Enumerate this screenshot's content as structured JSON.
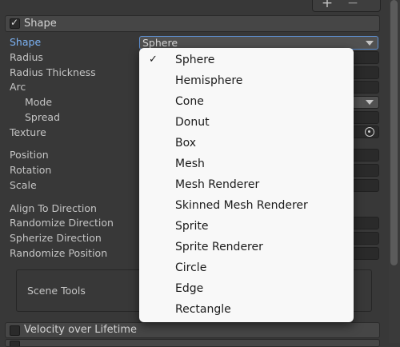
{
  "toolbar": {
    "plus": "+",
    "minus": "−"
  },
  "shape_module": {
    "title": "Shape",
    "enabled": true,
    "fields": {
      "shape": {
        "label": "Shape",
        "value": "Sphere"
      },
      "radius": "Radius",
      "radius_thickness": "Radius Thickness",
      "arc": "Arc",
      "mode": "Mode",
      "spread": "Spread",
      "texture": "Texture",
      "position": "Position",
      "rotation": "Rotation",
      "scale": "Scale",
      "align_to_direction": "Align To Direction",
      "randomize_direction": "Randomize Direction",
      "spherize_direction": "Spherize Direction",
      "randomize_position": "Randomize Position"
    },
    "scene_tools": "Scene Tools"
  },
  "velocity_module": {
    "title": "Velocity over Lifetime",
    "enabled": false
  },
  "shape_menu": {
    "selected": "Sphere",
    "check_glyph": "✓",
    "items": [
      "Sphere",
      "Hemisphere",
      "Cone",
      "Donut",
      "Box",
      "Mesh",
      "Mesh Renderer",
      "Skinned Mesh Renderer",
      "Sprite",
      "Sprite Renderer",
      "Circle",
      "Edge",
      "Rectangle"
    ]
  },
  "colors": {
    "panel_bg": "#383838",
    "active_label": "#7cb3f5",
    "menu_bg": "#f8f8f8",
    "focus_border": "#5e8fd0"
  }
}
